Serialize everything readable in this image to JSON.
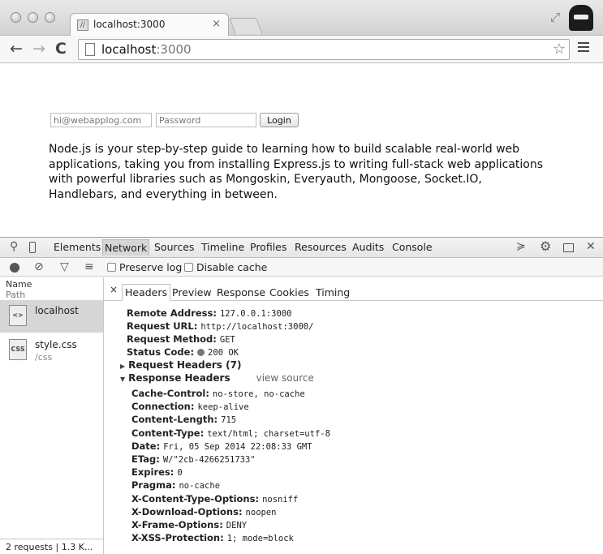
{
  "browser": {
    "tab_title": "localhost:3000",
    "tab_favicon": "//",
    "tab_close": "×",
    "url_host": "localhost",
    "url_port": ":3000",
    "back_glyph": "←",
    "forward_glyph": "→",
    "reload_glyph": "C",
    "star_glyph": "☆",
    "resize_glyph": "⤢"
  },
  "page": {
    "email_placeholder": "hi@webapplog.com",
    "password_placeholder": "Password",
    "login_label": "Login",
    "blurb": "Node.js is your step-by-step guide to learning how to build scalable real-world web applications, taking you from installing Express.js to writing full-stack web applications with powerful libraries such as Mongoskin, Everyauth, Mongoose, Socket.IO, Handlebars, and everything in between."
  },
  "devtools": {
    "tabs": [
      "Elements",
      "Network",
      "Sources",
      "Timeline",
      "Profiles",
      "Resources",
      "Audits",
      "Console"
    ],
    "active_tab": "Network",
    "network": {
      "preserve_log": "Preserve log",
      "disable_cache": "Disable cache",
      "col_name": "Name",
      "col_path": "Path",
      "requests": [
        {
          "name": "localhost",
          "path": "",
          "icon": "<>"
        },
        {
          "name": "style.css",
          "path": "/css",
          "icon": "CSS"
        }
      ],
      "summary": "2 requests | 1.3 K..."
    },
    "detail": {
      "close": "×",
      "tabs": [
        "Headers",
        "Preview",
        "Response",
        "Cookies",
        "Timing"
      ],
      "general": [
        {
          "key": "Remote Address:",
          "value": "127.0.0.1:3000"
        },
        {
          "key": "Request URL:",
          "value": "http://localhost:3000/"
        },
        {
          "key": "Request Method:",
          "value": "GET"
        },
        {
          "key": "Status Code:",
          "value": "200 OK"
        }
      ],
      "request_headers_title": "Request Headers (7)",
      "response_headers_title": "Response Headers",
      "view_source": "view source",
      "response_headers": [
        {
          "key": "Cache-Control:",
          "value": "no-store, no-cache"
        },
        {
          "key": "Connection:",
          "value": "keep-alive"
        },
        {
          "key": "Content-Length:",
          "value": "715"
        },
        {
          "key": "Content-Type:",
          "value": "text/html; charset=utf-8"
        },
        {
          "key": "Date:",
          "value": "Fri, 05 Sep 2014 22:08:33 GMT"
        },
        {
          "key": "ETag:",
          "value": "W/\"2cb-4266251733\""
        },
        {
          "key": "Expires:",
          "value": "0"
        },
        {
          "key": "Pragma:",
          "value": "no-cache"
        },
        {
          "key": "X-Content-Type-Options:",
          "value": "nosniff"
        },
        {
          "key": "X-Download-Options:",
          "value": "noopen"
        },
        {
          "key": "X-Frame-Options:",
          "value": "DENY"
        },
        {
          "key": "X-XSS-Protection:",
          "value": "1; mode=block"
        }
      ]
    }
  }
}
